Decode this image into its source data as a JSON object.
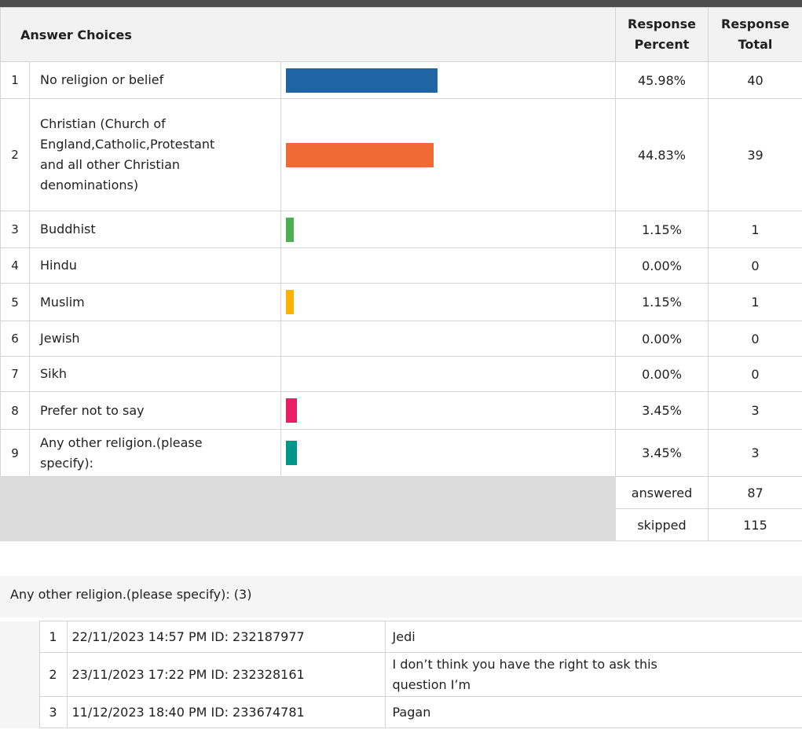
{
  "headers": {
    "answer_choices": "Answer Choices",
    "response_percent_line1": "Response",
    "response_percent_line2": "Percent",
    "response_total_line1": "Response",
    "response_total_line2": "Total"
  },
  "chart_data": {
    "type": "bar",
    "categories": [
      "No religion or belief",
      "Christian (Church of England,Catholic,Protestant and all other Christian denominations)",
      "Buddhist",
      "Hindu",
      "Muslim",
      "Jewish",
      "Sikh",
      "Prefer not to say",
      "Any other religion.(please specify):"
    ],
    "values": [
      45.98,
      44.83,
      1.15,
      0.0,
      1.15,
      0.0,
      0.0,
      3.45,
      3.45
    ],
    "colors": [
      "#2065a3",
      "#ef6a35",
      "#4caf50",
      "#9e9e9e",
      "#ffb300",
      "#9e9e9e",
      "#9e9e9e",
      "#e91e63",
      "#009688"
    ]
  },
  "rows": [
    {
      "num": "1",
      "label_lines": [
        "No religion or belief"
      ],
      "percent": "45.98%",
      "total": "40"
    },
    {
      "num": "2",
      "label_lines": [
        "Christian (Church of",
        "England,Catholic,Protestant",
        "and all other Christian",
        "denominations)"
      ],
      "percent": "44.83%",
      "total": "39"
    },
    {
      "num": "3",
      "label_lines": [
        "Buddhist"
      ],
      "percent": "1.15%",
      "total": "1"
    },
    {
      "num": "4",
      "label_lines": [
        "Hindu"
      ],
      "percent": "0.00%",
      "total": "0"
    },
    {
      "num": "5",
      "label_lines": [
        "Muslim"
      ],
      "percent": "1.15%",
      "total": "1"
    },
    {
      "num": "6",
      "label_lines": [
        "Jewish"
      ],
      "percent": "0.00%",
      "total": "0"
    },
    {
      "num": "7",
      "label_lines": [
        "Sikh"
      ],
      "percent": "0.00%",
      "total": "0"
    },
    {
      "num": "8",
      "label_lines": [
        "Prefer not to say"
      ],
      "percent": "3.45%",
      "total": "3"
    },
    {
      "num": "9",
      "label_lines": [
        "Any other religion.(please",
        "specify):"
      ],
      "percent": "3.45%",
      "total": "3"
    }
  ],
  "summary": {
    "answered_label": "answered",
    "answered_value": "87",
    "skipped_label": "skipped",
    "skipped_value": "115"
  },
  "other": {
    "title": "Any other religion.(please specify): (3)",
    "responses": [
      {
        "num": "1",
        "meta": "22/11/2023 14:57 PM ID: 232187977",
        "text_lines": [
          "Jedi"
        ]
      },
      {
        "num": "2",
        "meta": "23/11/2023 17:22 PM ID: 232328161",
        "text_lines": [
          "I don’t think you have the right to ask this",
          "question I’m"
        ]
      },
      {
        "num": "3",
        "meta": "11/12/2023 18:40 PM ID: 233674781",
        "text_lines": [
          "Pagan"
        ]
      }
    ]
  }
}
